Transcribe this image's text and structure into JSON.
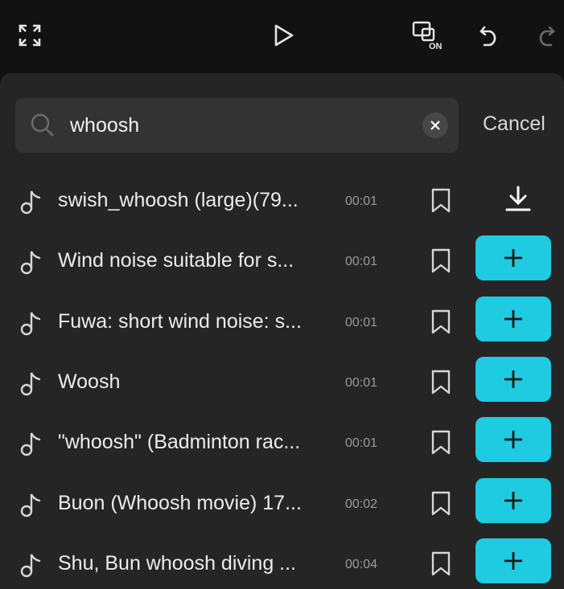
{
  "toolbar": {
    "buttons": [
      "fullscreen-icon",
      "play-icon",
      "preview-on-icon",
      "undo-icon",
      "redo-icon"
    ],
    "preview_badge": "ON"
  },
  "search": {
    "value": "whoosh",
    "cancel_label": "Cancel"
  },
  "results": [
    {
      "title": "swish_whoosh (large)(79...",
      "duration": "00:01",
      "action": "download"
    },
    {
      "title": "Wind noise suitable for s...",
      "duration": "00:01",
      "action": "add"
    },
    {
      "title": "Fuwa: short wind noise: s...",
      "duration": "00:01",
      "action": "add"
    },
    {
      "title": "Woosh",
      "duration": "00:01",
      "action": "add"
    },
    {
      "title": "\"whoosh\" (Badminton rac...",
      "duration": "00:01",
      "action": "add"
    },
    {
      "title": "Buon (Whoosh movie) 17...",
      "duration": "00:02",
      "action": "add"
    },
    {
      "title": "Shu, Bun whoosh diving ...",
      "duration": "00:04",
      "action": "add"
    }
  ],
  "colors": {
    "accent": "#1ecbe1",
    "panel": "#252525",
    "topbar": "#121212"
  }
}
